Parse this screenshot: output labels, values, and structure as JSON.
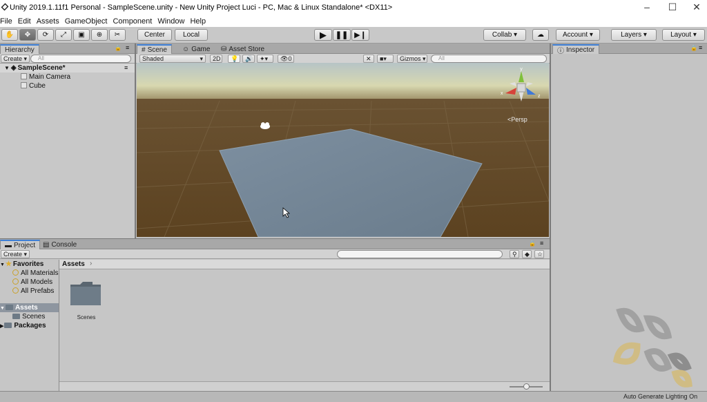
{
  "window": {
    "title": "Unity 2019.1.11f1 Personal - SampleScene.unity - New Unity Project Luci - PC, Mac & Linux Standalone* <DX11>"
  },
  "menu": [
    "File",
    "Edit",
    "Assets",
    "GameObject",
    "Component",
    "Window",
    "Help"
  ],
  "toolbar": {
    "pivot": "Center",
    "space": "Local",
    "collab": "Collab",
    "account": "Account",
    "layers": "Layers",
    "layout": "Layout"
  },
  "hierarchy": {
    "tab": "Hierarchy",
    "create": "Create",
    "search_placeholder": "All",
    "scene": "SampleScene*",
    "items": [
      "Main Camera",
      "Cube"
    ]
  },
  "scene_tabs": [
    "Scene",
    "Game",
    "Asset Store"
  ],
  "scene_toolbar": {
    "shading": "Shaded",
    "mode2d": "2D",
    "fx_count": "0",
    "gizmos": "Gizmos",
    "search_placeholder": "All"
  },
  "scene_view": {
    "projection": "Persp",
    "gizmo_axes": [
      "y",
      "x",
      "z"
    ]
  },
  "inspector": {
    "tab": "Inspector"
  },
  "bottom_tabs": [
    "Project",
    "Console"
  ],
  "project": {
    "create": "Create",
    "favorites_label": "Favorites",
    "favorites": [
      "All Materials",
      "All Models",
      "All Prefabs"
    ],
    "assets_label": "Assets",
    "assets_children": [
      "Scenes"
    ],
    "packages_label": "Packages",
    "breadcrumb": "Assets",
    "grid_items": [
      "Scenes"
    ]
  },
  "status": {
    "lighting": "Auto Generate Lighting On"
  }
}
